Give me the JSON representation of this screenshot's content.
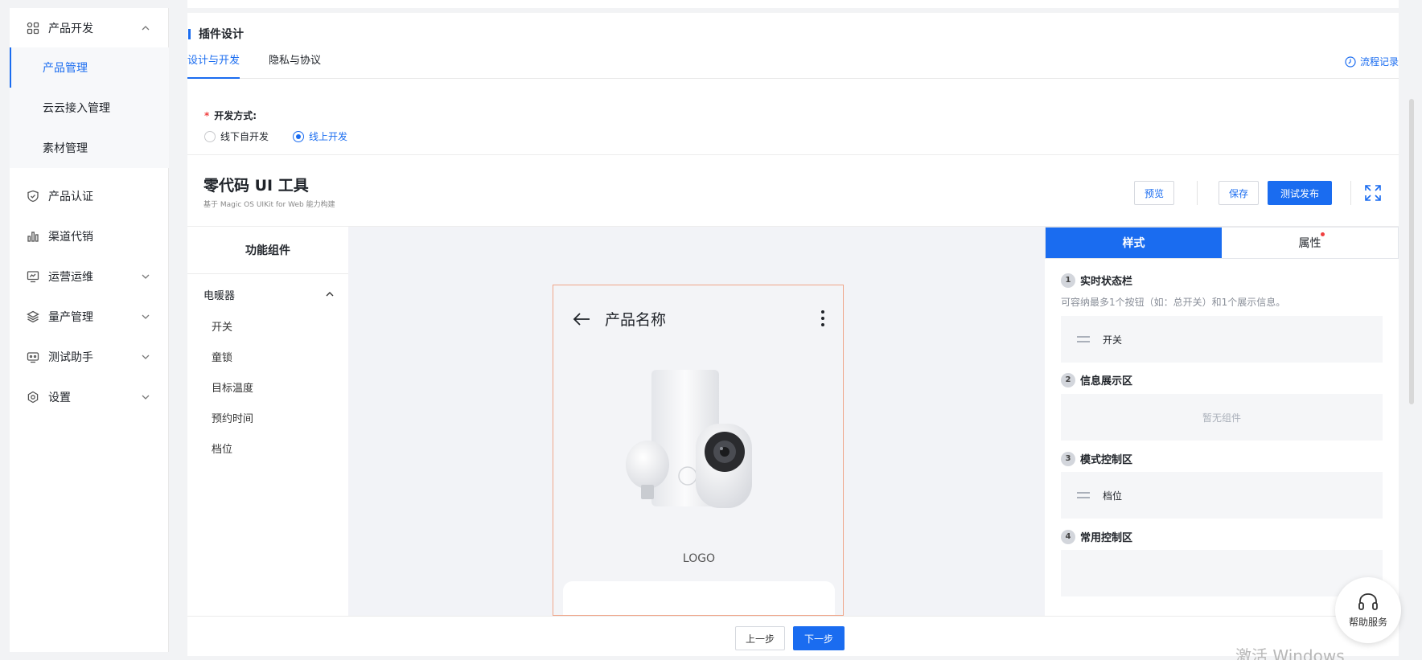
{
  "sidebar": {
    "items": [
      {
        "label": "产品开发",
        "icon": "grid-icon",
        "expanded": true
      },
      {
        "label": "产品认证",
        "icon": "shield-check-icon"
      },
      {
        "label": "渠道代销",
        "icon": "bar-chart-icon"
      },
      {
        "label": "运营运维",
        "icon": "monitor-icon",
        "expanded": false
      },
      {
        "label": "量产管理",
        "icon": "layers-icon",
        "expanded": false
      },
      {
        "label": "测试助手",
        "icon": "robot-icon",
        "expanded": false
      },
      {
        "label": "设置",
        "icon": "gear-icon",
        "expanded": false
      }
    ],
    "subitems": [
      {
        "label": "产品管理",
        "active": true
      },
      {
        "label": "云云接入管理"
      },
      {
        "label": "素材管理"
      }
    ]
  },
  "main": {
    "section_title": "插件设计",
    "tabs": [
      {
        "label": "设计与开发",
        "active": true
      },
      {
        "label": "隐私与协议"
      }
    ],
    "flow_record": "流程记录",
    "dev_method": {
      "required_mark": "*",
      "label": "开发方式:",
      "options": [
        {
          "label": "线下自开发",
          "selected": false
        },
        {
          "label": "线上开发",
          "selected": true
        }
      ]
    },
    "tool": {
      "title": "零代码 UI 工具",
      "subtitle": "基于 Magic OS UIKit for Web 能力构建",
      "preview": "预览",
      "save": "保存",
      "publish": "测试发布"
    },
    "components": {
      "header": "功能组件",
      "group": "电暖器",
      "items": [
        "开关",
        "童锁",
        "目标温度",
        "预约时间",
        "档位"
      ]
    },
    "phone": {
      "title": "产品名称",
      "logo": "LOGO"
    },
    "props": {
      "tabs": [
        "样式",
        "属性"
      ],
      "sections": [
        {
          "num": "1",
          "title": "实时状态栏",
          "desc": "可容纳最多1个按钮（如：总开关）和1个展示信息。",
          "slot": "开关"
        },
        {
          "num": "2",
          "title": "信息展示区",
          "slot": "暂无组件"
        },
        {
          "num": "3",
          "title": "模式控制区",
          "slot": "档位"
        },
        {
          "num": "4",
          "title": "常用控制区"
        }
      ]
    },
    "footer": {
      "prev": "上一步",
      "next": "下一步"
    }
  },
  "help": {
    "label": "帮助服务"
  },
  "watermark": "激活 Windows",
  "colors": {
    "primary": "#1a6cf0",
    "danger": "#f04040",
    "phone_border": "#f0a68a"
  }
}
